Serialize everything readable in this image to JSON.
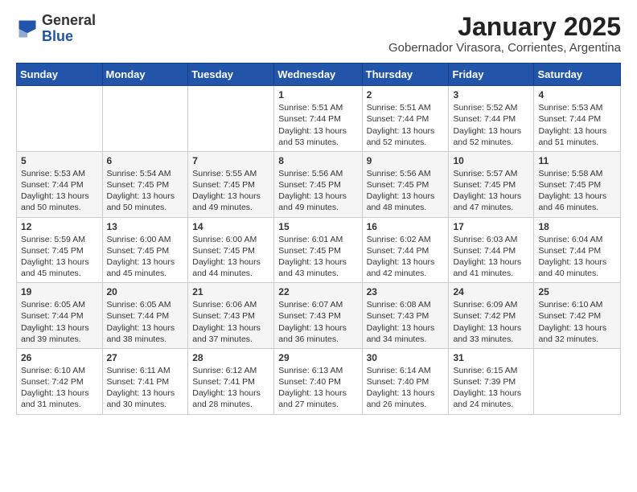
{
  "header": {
    "logo_general": "General",
    "logo_blue": "Blue",
    "title": "January 2025",
    "subtitle": "Gobernador Virasora, Corrientes, Argentina"
  },
  "days_of_week": [
    "Sunday",
    "Monday",
    "Tuesday",
    "Wednesday",
    "Thursday",
    "Friday",
    "Saturday"
  ],
  "weeks": [
    [
      {
        "day": "",
        "info": ""
      },
      {
        "day": "",
        "info": ""
      },
      {
        "day": "",
        "info": ""
      },
      {
        "day": "1",
        "info": "Sunrise: 5:51 AM\nSunset: 7:44 PM\nDaylight: 13 hours\nand 53 minutes."
      },
      {
        "day": "2",
        "info": "Sunrise: 5:51 AM\nSunset: 7:44 PM\nDaylight: 13 hours\nand 52 minutes."
      },
      {
        "day": "3",
        "info": "Sunrise: 5:52 AM\nSunset: 7:44 PM\nDaylight: 13 hours\nand 52 minutes."
      },
      {
        "day": "4",
        "info": "Sunrise: 5:53 AM\nSunset: 7:44 PM\nDaylight: 13 hours\nand 51 minutes."
      }
    ],
    [
      {
        "day": "5",
        "info": "Sunrise: 5:53 AM\nSunset: 7:44 PM\nDaylight: 13 hours\nand 50 minutes."
      },
      {
        "day": "6",
        "info": "Sunrise: 5:54 AM\nSunset: 7:45 PM\nDaylight: 13 hours\nand 50 minutes."
      },
      {
        "day": "7",
        "info": "Sunrise: 5:55 AM\nSunset: 7:45 PM\nDaylight: 13 hours\nand 49 minutes."
      },
      {
        "day": "8",
        "info": "Sunrise: 5:56 AM\nSunset: 7:45 PM\nDaylight: 13 hours\nand 49 minutes."
      },
      {
        "day": "9",
        "info": "Sunrise: 5:56 AM\nSunset: 7:45 PM\nDaylight: 13 hours\nand 48 minutes."
      },
      {
        "day": "10",
        "info": "Sunrise: 5:57 AM\nSunset: 7:45 PM\nDaylight: 13 hours\nand 47 minutes."
      },
      {
        "day": "11",
        "info": "Sunrise: 5:58 AM\nSunset: 7:45 PM\nDaylight: 13 hours\nand 46 minutes."
      }
    ],
    [
      {
        "day": "12",
        "info": "Sunrise: 5:59 AM\nSunset: 7:45 PM\nDaylight: 13 hours\nand 45 minutes."
      },
      {
        "day": "13",
        "info": "Sunrise: 6:00 AM\nSunset: 7:45 PM\nDaylight: 13 hours\nand 45 minutes."
      },
      {
        "day": "14",
        "info": "Sunrise: 6:00 AM\nSunset: 7:45 PM\nDaylight: 13 hours\nand 44 minutes."
      },
      {
        "day": "15",
        "info": "Sunrise: 6:01 AM\nSunset: 7:45 PM\nDaylight: 13 hours\nand 43 minutes."
      },
      {
        "day": "16",
        "info": "Sunrise: 6:02 AM\nSunset: 7:44 PM\nDaylight: 13 hours\nand 42 minutes."
      },
      {
        "day": "17",
        "info": "Sunrise: 6:03 AM\nSunset: 7:44 PM\nDaylight: 13 hours\nand 41 minutes."
      },
      {
        "day": "18",
        "info": "Sunrise: 6:04 AM\nSunset: 7:44 PM\nDaylight: 13 hours\nand 40 minutes."
      }
    ],
    [
      {
        "day": "19",
        "info": "Sunrise: 6:05 AM\nSunset: 7:44 PM\nDaylight: 13 hours\nand 39 minutes."
      },
      {
        "day": "20",
        "info": "Sunrise: 6:05 AM\nSunset: 7:44 PM\nDaylight: 13 hours\nand 38 minutes."
      },
      {
        "day": "21",
        "info": "Sunrise: 6:06 AM\nSunset: 7:43 PM\nDaylight: 13 hours\nand 37 minutes."
      },
      {
        "day": "22",
        "info": "Sunrise: 6:07 AM\nSunset: 7:43 PM\nDaylight: 13 hours\nand 36 minutes."
      },
      {
        "day": "23",
        "info": "Sunrise: 6:08 AM\nSunset: 7:43 PM\nDaylight: 13 hours\nand 34 minutes."
      },
      {
        "day": "24",
        "info": "Sunrise: 6:09 AM\nSunset: 7:42 PM\nDaylight: 13 hours\nand 33 minutes."
      },
      {
        "day": "25",
        "info": "Sunrise: 6:10 AM\nSunset: 7:42 PM\nDaylight: 13 hours\nand 32 minutes."
      }
    ],
    [
      {
        "day": "26",
        "info": "Sunrise: 6:10 AM\nSunset: 7:42 PM\nDaylight: 13 hours\nand 31 minutes."
      },
      {
        "day": "27",
        "info": "Sunrise: 6:11 AM\nSunset: 7:41 PM\nDaylight: 13 hours\nand 30 minutes."
      },
      {
        "day": "28",
        "info": "Sunrise: 6:12 AM\nSunset: 7:41 PM\nDaylight: 13 hours\nand 28 minutes."
      },
      {
        "day": "29",
        "info": "Sunrise: 6:13 AM\nSunset: 7:40 PM\nDaylight: 13 hours\nand 27 minutes."
      },
      {
        "day": "30",
        "info": "Sunrise: 6:14 AM\nSunset: 7:40 PM\nDaylight: 13 hours\nand 26 minutes."
      },
      {
        "day": "31",
        "info": "Sunrise: 6:15 AM\nSunset: 7:39 PM\nDaylight: 13 hours\nand 24 minutes."
      },
      {
        "day": "",
        "info": ""
      }
    ]
  ]
}
